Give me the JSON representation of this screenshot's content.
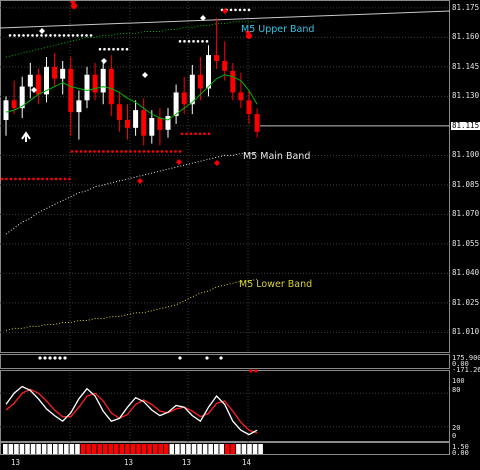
{
  "colors": {
    "background": "#000000",
    "grid": "#3c3c3c",
    "bull": "#ffffff",
    "bear": "#ff0000",
    "ma_line": "#00b400",
    "upper_band": "#33c4e6",
    "main_band": "#e6e6e6",
    "lower_band": "#d8d23a",
    "osc_fast": "#ffffff",
    "osc_slow": "#ff2020"
  },
  "price_axis": {
    "labels": [
      "81.175",
      "81.160",
      "81.145",
      "81.130",
      "81.115",
      "81.100",
      "81.085",
      "81.070",
      "81.055",
      "81.040",
      "81.025",
      "81.010"
    ],
    "current_price": "81.115"
  },
  "bands": {
    "upper": "M5 Upper Band",
    "main": "M5 Main Band",
    "lower": "M5 Lower Band"
  },
  "indicator1_axis": [
    "175.900",
    "0.00",
    "-171.26"
  ],
  "oscillator_axis": [
    "100",
    "80",
    "20",
    "0"
  ],
  "indicator3_axis": [
    "1.50",
    "0.00"
  ],
  "time_axis": [
    "13",
    "13",
    "13",
    "14",
    "14"
  ],
  "chart_data": {
    "type": "candlestick",
    "ylim": [
      81.0,
      81.178
    ],
    "candles": [
      [
        81.118,
        81.13,
        81.11,
        81.128
      ],
      [
        81.128,
        81.138,
        81.121,
        81.124
      ],
      [
        81.124,
        81.14,
        81.119,
        81.135
      ],
      [
        81.135,
        81.147,
        81.129,
        81.141
      ],
      [
        81.141,
        81.144,
        81.126,
        81.131
      ],
      [
        81.131,
        81.15,
        81.127,
        81.145
      ],
      [
        81.145,
        81.152,
        81.135,
        81.139
      ],
      [
        81.139,
        81.148,
        81.131,
        81.144
      ],
      [
        81.144,
        81.15,
        81.11,
        81.122
      ],
      [
        81.122,
        81.133,
        81.108,
        81.128
      ],
      [
        81.128,
        81.145,
        81.124,
        81.141
      ],
      [
        81.141,
        81.147,
        81.128,
        81.132
      ],
      [
        81.132,
        81.149,
        81.126,
        81.144
      ],
      [
        81.144,
        81.151,
        81.12,
        81.126
      ],
      [
        81.126,
        81.132,
        81.112,
        81.118
      ],
      [
        81.118,
        81.126,
        81.108,
        81.114
      ],
      [
        81.114,
        81.128,
        81.11,
        81.123
      ],
      [
        81.123,
        81.129,
        81.105,
        81.11
      ],
      [
        81.11,
        81.123,
        81.106,
        81.119
      ],
      [
        81.119,
        81.124,
        81.105,
        81.113
      ],
      [
        81.113,
        81.124,
        81.109,
        81.12
      ],
      [
        81.12,
        81.136,
        81.116,
        81.132
      ],
      [
        81.132,
        81.14,
        81.121,
        81.126
      ],
      [
        81.126,
        81.146,
        81.121,
        81.141
      ],
      [
        81.141,
        81.15,
        81.128,
        81.134
      ],
      [
        81.134,
        81.156,
        81.13,
        81.151
      ],
      [
        81.151,
        81.17,
        81.144,
        81.148
      ],
      [
        81.148,
        81.158,
        81.138,
        81.143
      ],
      [
        81.143,
        81.147,
        81.128,
        81.132
      ],
      [
        81.132,
        81.142,
        81.124,
        81.128
      ],
      [
        81.128,
        81.133,
        81.116,
        81.121
      ],
      [
        81.121,
        81.124,
        81.109,
        81.112
      ]
    ],
    "ma": [
      81.122,
      81.123,
      81.125,
      81.128,
      81.131,
      81.133,
      81.135,
      81.137,
      81.135,
      81.134,
      81.133,
      81.134,
      81.135,
      81.134,
      81.132,
      81.129,
      81.127,
      81.124,
      81.121,
      81.119,
      81.118,
      81.121,
      81.124,
      81.127,
      81.131,
      81.135,
      81.139,
      81.141,
      81.14,
      81.138,
      81.133,
      81.126
    ],
    "upper_band": [
      81.15,
      81.151,
      81.152,
      81.153,
      81.154,
      81.155,
      81.156,
      81.157,
      81.158,
      81.159,
      81.16,
      81.16,
      81.161,
      81.161,
      81.162,
      81.162,
      81.162,
      81.163,
      81.163,
      81.163,
      81.164,
      81.164,
      81.165,
      81.165,
      81.166,
      81.166,
      81.167,
      81.167,
      81.168,
      81.168,
      81.168,
      81.168
    ],
    "main_band": [
      81.06,
      81.063,
      81.066,
      81.068,
      81.071,
      81.073,
      81.075,
      81.077,
      81.079,
      81.081,
      81.082,
      81.084,
      81.085,
      81.086,
      81.087,
      81.088,
      81.089,
      81.09,
      81.091,
      81.092,
      81.093,
      81.094,
      81.095,
      81.096,
      81.097,
      81.098,
      81.099,
      81.1,
      81.1,
      81.101,
      81.101,
      81.101
    ],
    "lower_band": [
      81.011,
      81.012,
      81.012,
      81.013,
      81.013,
      81.014,
      81.014,
      81.015,
      81.015,
      81.016,
      81.016,
      81.017,
      81.017,
      81.018,
      81.018,
      81.019,
      81.02,
      81.02,
      81.021,
      81.022,
      81.023,
      81.024,
      81.026,
      81.028,
      81.03,
      81.031,
      81.033,
      81.034,
      81.035,
      81.036,
      81.036,
      81.037
    ],
    "osc_fast": [
      60,
      80,
      92,
      85,
      70,
      52,
      40,
      30,
      45,
      70,
      88,
      75,
      48,
      30,
      35,
      55,
      72,
      65,
      50,
      40,
      46,
      58,
      55,
      40,
      30,
      55,
      75,
      60,
      30,
      14,
      6,
      14
    ],
    "osc_slow": [
      50,
      62,
      80,
      87,
      80,
      66,
      50,
      38,
      38,
      55,
      75,
      80,
      66,
      45,
      35,
      42,
      60,
      68,
      60,
      48,
      45,
      52,
      55,
      48,
      38,
      44,
      62,
      66,
      48,
      28,
      14,
      9
    ],
    "bar_flags": [
      0,
      0,
      0,
      0,
      0,
      0,
      0,
      0,
      0,
      0,
      0,
      0,
      0,
      0,
      1,
      1,
      1,
      1,
      1,
      1,
      1,
      1,
      1,
      1,
      1,
      1,
      1,
      1,
      1,
      1,
      0,
      0,
      0,
      0,
      0,
      0,
      0,
      0,
      0,
      0,
      1,
      1,
      0,
      0,
      0,
      0,
      0
    ]
  }
}
